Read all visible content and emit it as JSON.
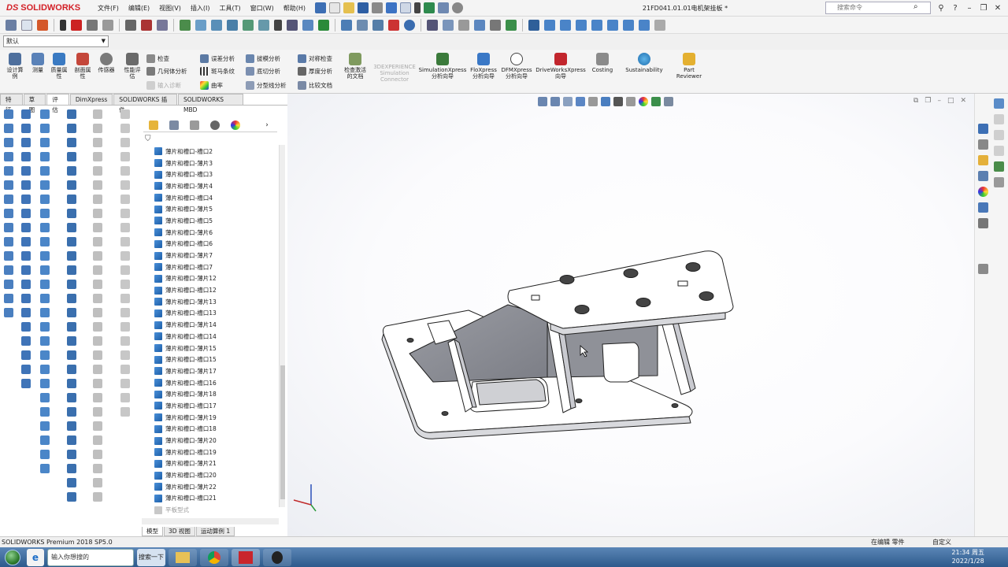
{
  "app": {
    "logo": "SOLIDWORKS",
    "logo_mark": "DS",
    "doc_title": "21FD041.01.01电机架挂板 *",
    "search_placeholder": "搜索命令",
    "menu": [
      "文件(F)",
      "编辑(E)",
      "视图(V)",
      "插入(I)",
      "工具(T)",
      "窗口(W)",
      "帮助(H)"
    ]
  },
  "config": {
    "selected": "默认"
  },
  "ribbon": {
    "large": [
      {
        "label": "设计算\n例"
      },
      {
        "label": "测量"
      },
      {
        "label": "质量属\n性"
      },
      {
        "label": "剖面属\n性"
      },
      {
        "label": "传感器"
      },
      {
        "label": "性能评\n估"
      },
      {
        "label": "检查激活\n的文档"
      },
      {
        "label": "3DEXPERIENCE\nSimulation\nConnector"
      },
      {
        "label": "SimulationXpress\n分析向导"
      },
      {
        "label": "FloXpress\n分析向导"
      },
      {
        "label": "DFMXpress\n分析向导"
      },
      {
        "label": "DriveWorksXpress\n向导"
      },
      {
        "label": "Costing"
      },
      {
        "label": "Sustainability"
      },
      {
        "label": "Part\nReviewer"
      }
    ],
    "small": [
      {
        "label": "检查"
      },
      {
        "label": "几何体分析"
      },
      {
        "label": "输入诊断"
      },
      {
        "label": "误差分析"
      },
      {
        "label": "斑马条纹"
      },
      {
        "label": "曲率"
      },
      {
        "label": "拔模分析"
      },
      {
        "label": "底切分析"
      },
      {
        "label": "分型线分析"
      },
      {
        "label": "对称检查"
      },
      {
        "label": "厚度分析"
      },
      {
        "label": "比较文档"
      }
    ]
  },
  "tabs": [
    "特征",
    "草图",
    "评估",
    "DimXpress",
    "SOLIDWORKS 插件",
    "SOLIDWORKS MBD"
  ],
  "active_tab": "评估",
  "feature_tree": [
    "薄片和槽口-槽口2",
    "薄片和槽口-薄片3",
    "薄片和槽口-槽口3",
    "薄片和槽口-薄片4",
    "薄片和槽口-槽口4",
    "薄片和槽口-薄片5",
    "薄片和槽口-槽口5",
    "薄片和槽口-薄片6",
    "薄片和槽口-槽口6",
    "薄片和槽口-薄片7",
    "薄片和槽口-槽口7",
    "薄片和槽口-薄片12",
    "薄片和槽口-槽口12",
    "薄片和槽口-薄片13",
    "薄片和槽口-槽口13",
    "薄片和槽口-薄片14",
    "薄片和槽口-槽口14",
    "薄片和槽口-薄片15",
    "薄片和槽口-槽口15",
    "薄片和槽口-薄片17",
    "薄片和槽口-槽口16",
    "薄片和槽口-薄片18",
    "薄片和槽口-槽口17",
    "薄片和槽口-薄片19",
    "薄片和槽口-槽口18",
    "薄片和槽口-薄片20",
    "薄片和槽口-槽口19",
    "薄片和槽口-薄片21",
    "薄片和槽口-槽口20",
    "薄片和槽口-薄片22",
    "薄片和槽口-槽口21"
  ],
  "feature_tree_dim": "平板型式",
  "bottom_tabs": [
    "模型",
    "3D 视图",
    "运动算例 1"
  ],
  "status": {
    "left": "SOLIDWORKS Premium 2018 SP5.0",
    "mode": "在编辑 零件",
    "custom": "自定义"
  },
  "taskbar": {
    "ie_text": "输入你想搜的",
    "search_button": "搜索一下",
    "time": "21:34 周五",
    "date": "2022/1/28"
  },
  "colors": {
    "logo_red": "#d32027",
    "part_face": "#ffffff",
    "part_shadow": "#8d8f96",
    "taskbar": "#3a6aa0"
  }
}
